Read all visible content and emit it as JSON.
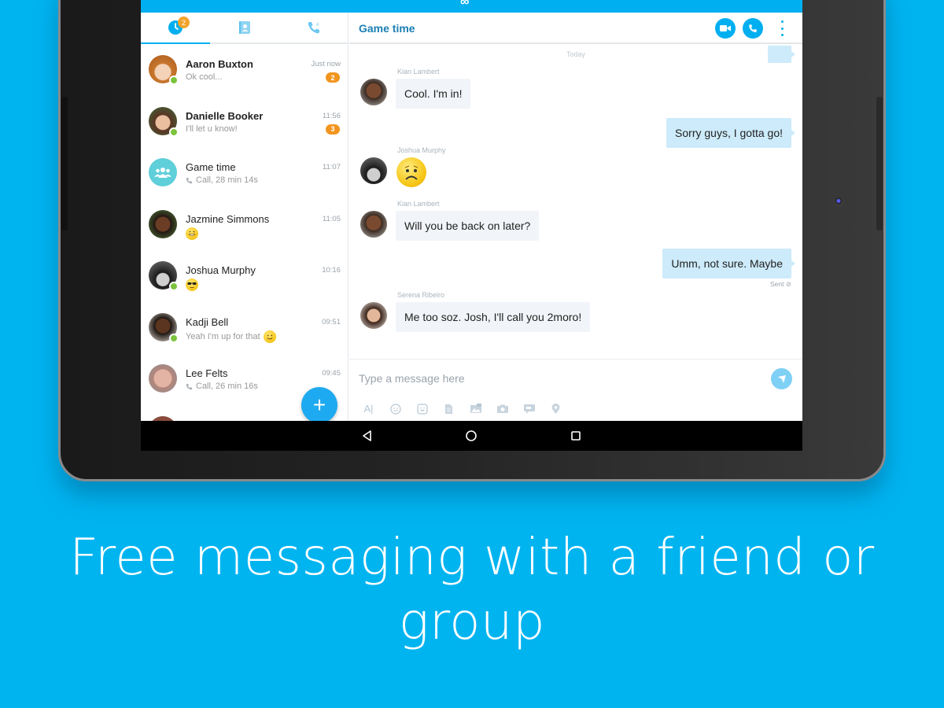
{
  "app": {
    "logo_glyph": "∞"
  },
  "tabs": [
    {
      "name": "recent",
      "icon": "clock-icon",
      "badge": "2",
      "active": true
    },
    {
      "name": "contacts",
      "icon": "contacts-icon",
      "active": false
    },
    {
      "name": "calls",
      "icon": "dialpad-phone-icon",
      "active": false
    }
  ],
  "chats": [
    {
      "name": "Aaron Buxton",
      "preview": "Ok cool...",
      "time": "Just now",
      "unread": "2",
      "online": true,
      "bold": true
    },
    {
      "name": "Danielle Booker",
      "preview": "I'll let u know!",
      "time": "11:56",
      "unread": "3",
      "online": true,
      "bold": true
    },
    {
      "name": "Game time",
      "preview": "Call, 28 min 14s",
      "time": "11:07",
      "group": true,
      "call": true
    },
    {
      "name": "Jazmine Simmons",
      "preview": "",
      "time": "11:05",
      "emoji": "grin-emoji"
    },
    {
      "name": "Joshua Murphy",
      "preview": "",
      "time": "10:16",
      "emoji": "cool-emoji",
      "online": true
    },
    {
      "name": "Kadji Bell",
      "preview": "Yeah I'm up for that",
      "time": "09:51",
      "emoji": "smile-emoji",
      "online": true
    },
    {
      "name": "Lee Felts",
      "preview": "Call, 26 min 16s",
      "time": "09:45",
      "call": true
    }
  ],
  "fab": {
    "label": "+"
  },
  "conversation": {
    "title": "Game time",
    "day_label": "Today",
    "messages": [
      {
        "sender": "Kian Lambert",
        "text": "Cool. I'm in!",
        "direction": "in"
      },
      {
        "text": "Sorry guys, I gotta go!",
        "direction": "out"
      },
      {
        "sender": "Joshua Murphy",
        "emoji": "sad-emoji",
        "direction": "in"
      },
      {
        "sender": "Kian Lambert",
        "text": "Will you be back on later?",
        "direction": "in"
      },
      {
        "text": "Umm, not sure. Maybe",
        "direction": "out",
        "status": "Sent"
      },
      {
        "sender": "Serena Ribeiro",
        "text": "Me too soz. Josh, I'll call you 2moro!",
        "direction": "in"
      }
    ]
  },
  "composer": {
    "placeholder": "Type a message here",
    "tools": [
      "text-format-icon",
      "emoticon-icon",
      "mojis-icon",
      "file-icon",
      "photo-icon",
      "camera-icon",
      "video-message-icon",
      "location-icon"
    ]
  },
  "tagline": "Free messaging with a friend or group",
  "colors": {
    "background": "#00b4f0",
    "accent": "#00aff0",
    "unread_badge": "#f2951e",
    "presence_online": "#7cc33d",
    "outgoing_bubble": "#cdebfa",
    "incoming_bubble": "#f1f4f8",
    "title_text": "#1a7fb3"
  }
}
